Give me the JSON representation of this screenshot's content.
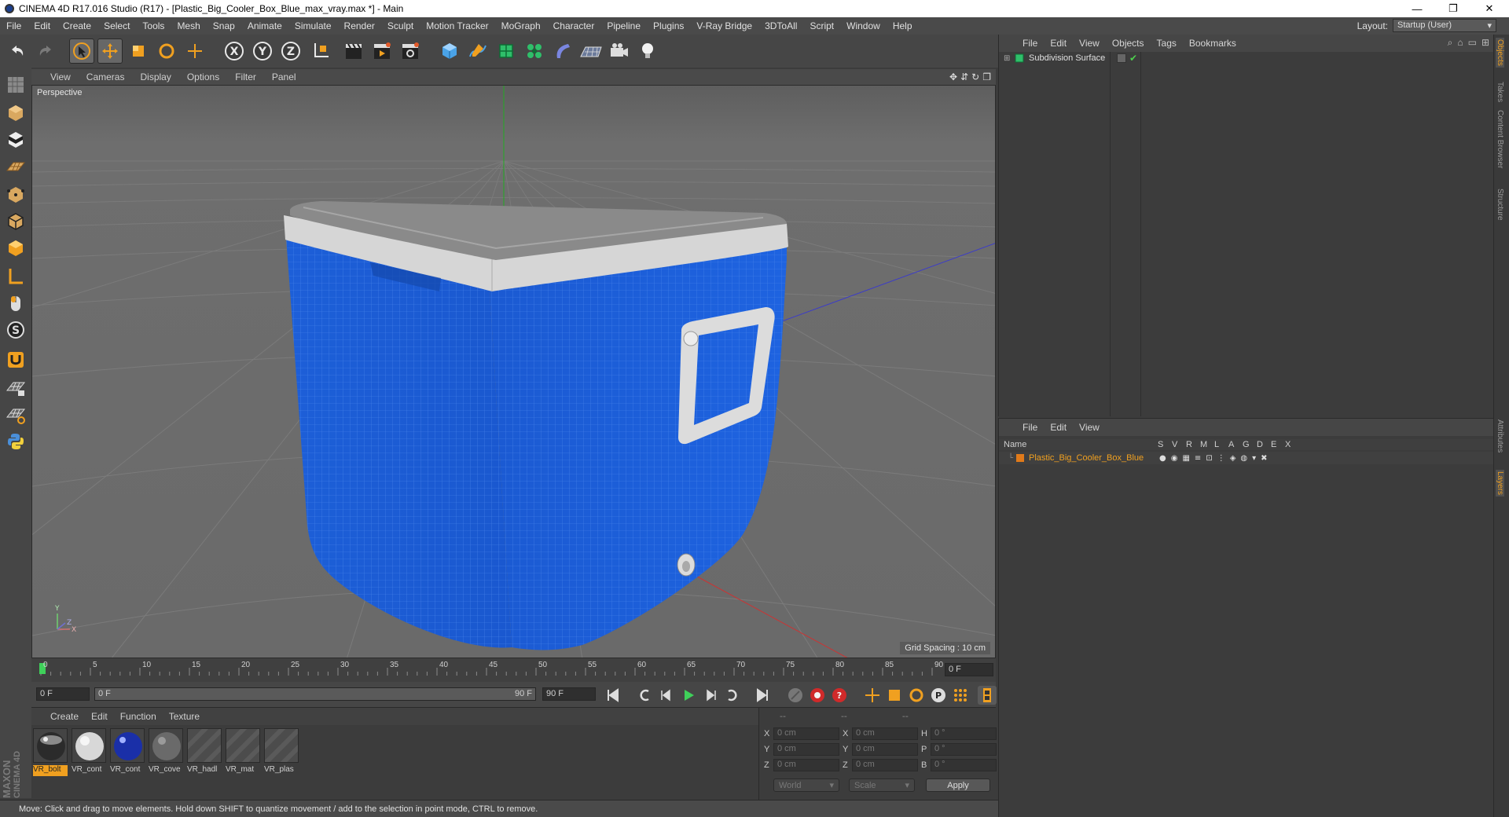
{
  "window": {
    "title": "CINEMA 4D R17.016 Studio (R17) - [Plastic_Big_Cooler_Box_Blue_max_vray.max *] - Main",
    "minimize": "—",
    "maximize": "❐",
    "close": "✕"
  },
  "menubar": {
    "items": [
      "File",
      "Edit",
      "Create",
      "Select",
      "Tools",
      "Mesh",
      "Snap",
      "Animate",
      "Simulate",
      "Render",
      "Sculpt",
      "Motion Tracker",
      "MoGraph",
      "Character",
      "Pipeline",
      "Plugins",
      "V-Ray Bridge",
      "3DToAll",
      "Script",
      "Window",
      "Help"
    ],
    "layout_label": "Layout:",
    "layout_value": "Startup (User)"
  },
  "toolbar": {
    "axis_x": "X",
    "axis_y": "Y",
    "axis_z": "Z"
  },
  "viewport": {
    "menu": [
      "View",
      "Cameras",
      "Display",
      "Options",
      "Filter",
      "Panel"
    ],
    "label": "Perspective",
    "grid_spacing": "Grid Spacing : 10 cm"
  },
  "timeline": {
    "ticks": [
      "0",
      "5",
      "10",
      "15",
      "20",
      "25",
      "30",
      "35",
      "40",
      "45",
      "50",
      "55",
      "60",
      "65",
      "70",
      "75",
      "80",
      "85",
      "90"
    ],
    "current_frame": "0 F"
  },
  "transport": {
    "start_field": "0 F",
    "range_start": "0 F",
    "range_end": "90 F",
    "end_field": "90 F"
  },
  "materials": {
    "menu": [
      "Create",
      "Edit",
      "Function",
      "Texture"
    ],
    "items": [
      {
        "label": "VR_bolt",
        "selected": true
      },
      {
        "label": "VR_cont",
        "selected": false
      },
      {
        "label": "VR_cont",
        "selected": false
      },
      {
        "label": "VR_cove",
        "selected": false
      },
      {
        "label": "VR_hadl",
        "selected": false
      },
      {
        "label": "VR_mat",
        "selected": false
      },
      {
        "label": "VR_plas",
        "selected": false
      }
    ]
  },
  "coordinates": {
    "header": [
      "--",
      "--",
      "--"
    ],
    "rows": [
      {
        "a": "X",
        "av": "0 cm",
        "b": "X",
        "bv": "0 cm",
        "c": "H",
        "cv": "0 °"
      },
      {
        "a": "Y",
        "av": "0 cm",
        "b": "Y",
        "bv": "0 cm",
        "c": "P",
        "cv": "0 °"
      },
      {
        "a": "Z",
        "av": "0 cm",
        "b": "Z",
        "bv": "0 cm",
        "c": "B",
        "cv": "0 °"
      }
    ],
    "mode1": "World",
    "mode2": "Scale",
    "apply": "Apply"
  },
  "object_manager": {
    "menu": [
      "File",
      "Edit",
      "View",
      "Objects",
      "Tags",
      "Bookmarks"
    ],
    "objects": [
      {
        "name": "Subdivision Surface"
      }
    ]
  },
  "layer_manager": {
    "menu": [
      "File",
      "Edit",
      "View"
    ],
    "col_name": "Name",
    "cols": [
      "S",
      "V",
      "R",
      "M",
      "L",
      "A",
      "G",
      "D",
      "E",
      "X"
    ],
    "layers": [
      {
        "name": "Plastic_Big_Cooler_Box_Blue",
        "color": "#e07a1a"
      }
    ]
  },
  "side_tabs": [
    "Objects",
    "Takes",
    "Content Browser",
    "Structure",
    "Attributes",
    "Layers"
  ],
  "logo": {
    "line1": "MAXON",
    "line2": "CINEMA 4D"
  },
  "status": "Move: Click and drag to move elements. Hold down SHIFT to quantize movement / add to the selection in point mode, CTRL to remove.",
  "colors": {
    "accent": "#f0a020",
    "cooler_blue": "#1a5fdc",
    "selection_orange": "#e07a1a"
  }
}
